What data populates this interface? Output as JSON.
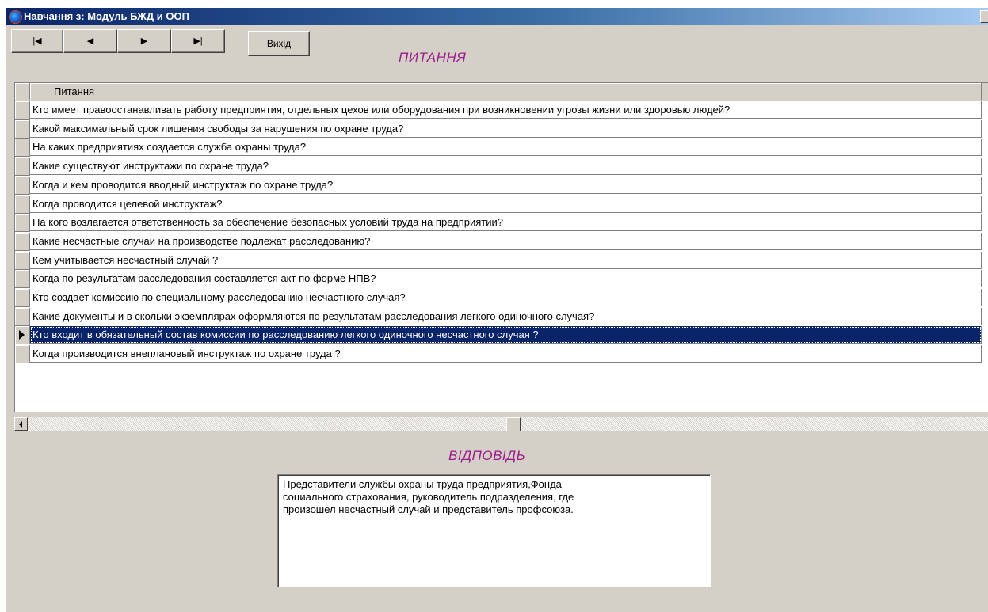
{
  "window": {
    "title": "Навчання з: Модуль БЖД и ООП"
  },
  "toolbar": {
    "first_label": "|◀",
    "prev_label": "◀",
    "next_label": "▶",
    "last_label": "▶|",
    "exit_label": "Вихід"
  },
  "questions_title": "ПИТАННЯ",
  "answer_title": "ВІДПОВІДЬ",
  "grid": {
    "column_header": "Питання",
    "selected_index": 12,
    "rows": [
      "Кто имеет правоостанавливать работу предприятия, отдельных цехов или оборудования при возникновении угрозы жизни или здоровью людей?",
      "Какой максимальный срок лишения свободы за нарушения по охране труда?",
      "На каких предприятиях создается служба охраны труда?",
      "Какие существуют инструктажи по охране труда?",
      "Когда и кем проводится вводный инструктаж по охране труда?",
      " Когда проводится целевой инструктаж?",
      "На кого возлагается ответственность за обеспечение безопасных условий труда на предприятии?",
      "Какие несчастные случаи на производстве подлежат расследованию?",
      "Кем учитывается несчастный случай ?",
      "Когда по результатам расследования составляется акт по форме НПВ?",
      "Кто создает комиссию по специальному расследованию несчастного случая?",
      "Какие документы и в скольки экземплярах оформляются по результатам расследования легкого одиночного случая?",
      "Кто входит в обязательный состав комиссии по расследованию легкого одиночного несчастного случая ?",
      "Когда производится внеплановый инструктаж по охране труда ?"
    ]
  },
  "answer_text": "Представители службы охраны труда предприятия,Фонда\nсоциального страхования, руководитель подразделения, где\nпроизошел несчастный случай и представитель профсоюза.",
  "colors": {
    "title_accent": "#9c1a8a",
    "selection": "#0a246a",
    "window_bg": "#d4d0c8"
  }
}
